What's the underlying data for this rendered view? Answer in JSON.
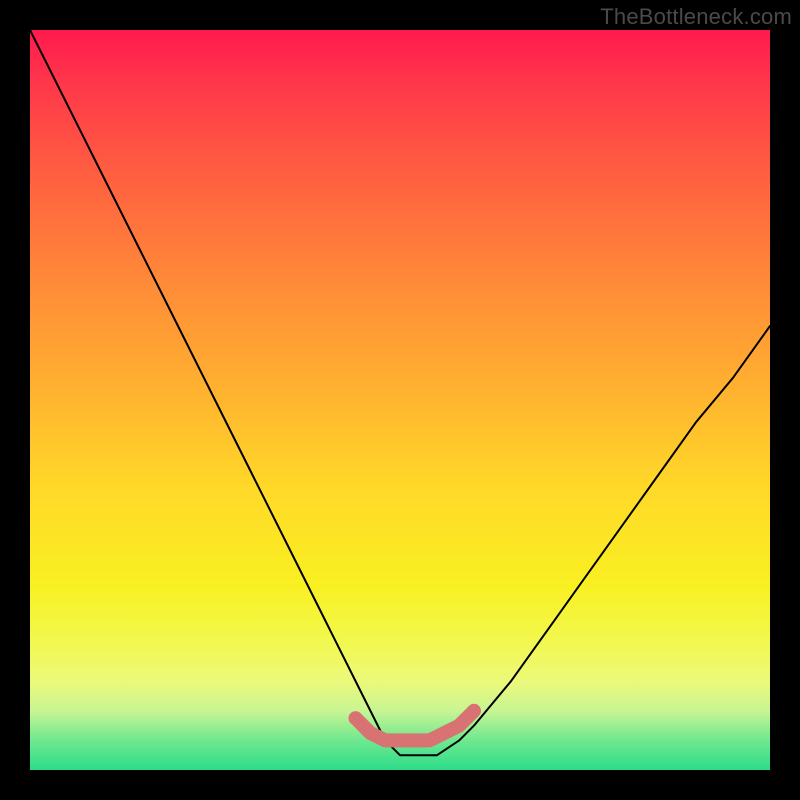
{
  "watermark": "TheBottleneck.com",
  "chart_data": {
    "type": "line",
    "title": "",
    "xlabel": "",
    "ylabel": "",
    "xlim": [
      0,
      100
    ],
    "ylim": [
      0,
      100
    ],
    "series": [
      {
        "name": "bottleneck-curve",
        "x": [
          0,
          5,
          10,
          15,
          20,
          25,
          30,
          35,
          40,
          45,
          48,
          50,
          52,
          55,
          58,
          60,
          65,
          70,
          75,
          80,
          85,
          90,
          95,
          100
        ],
        "values": [
          100,
          90,
          80,
          70,
          60,
          50,
          40,
          30,
          20,
          10,
          4,
          2,
          2,
          2,
          4,
          6,
          12,
          19,
          26,
          33,
          40,
          47,
          53,
          60
        ]
      }
    ],
    "marker_segment": {
      "comment": "thick salmon segment near the trough",
      "x": [
        44,
        46,
        48,
        50,
        52,
        54,
        56,
        58,
        60
      ],
      "values": [
        7,
        5,
        4,
        4,
        4,
        4,
        5,
        6,
        8
      ]
    }
  },
  "colors": {
    "curve": "#000000",
    "marker": "#d97373",
    "marker_dot": "#d97373"
  }
}
